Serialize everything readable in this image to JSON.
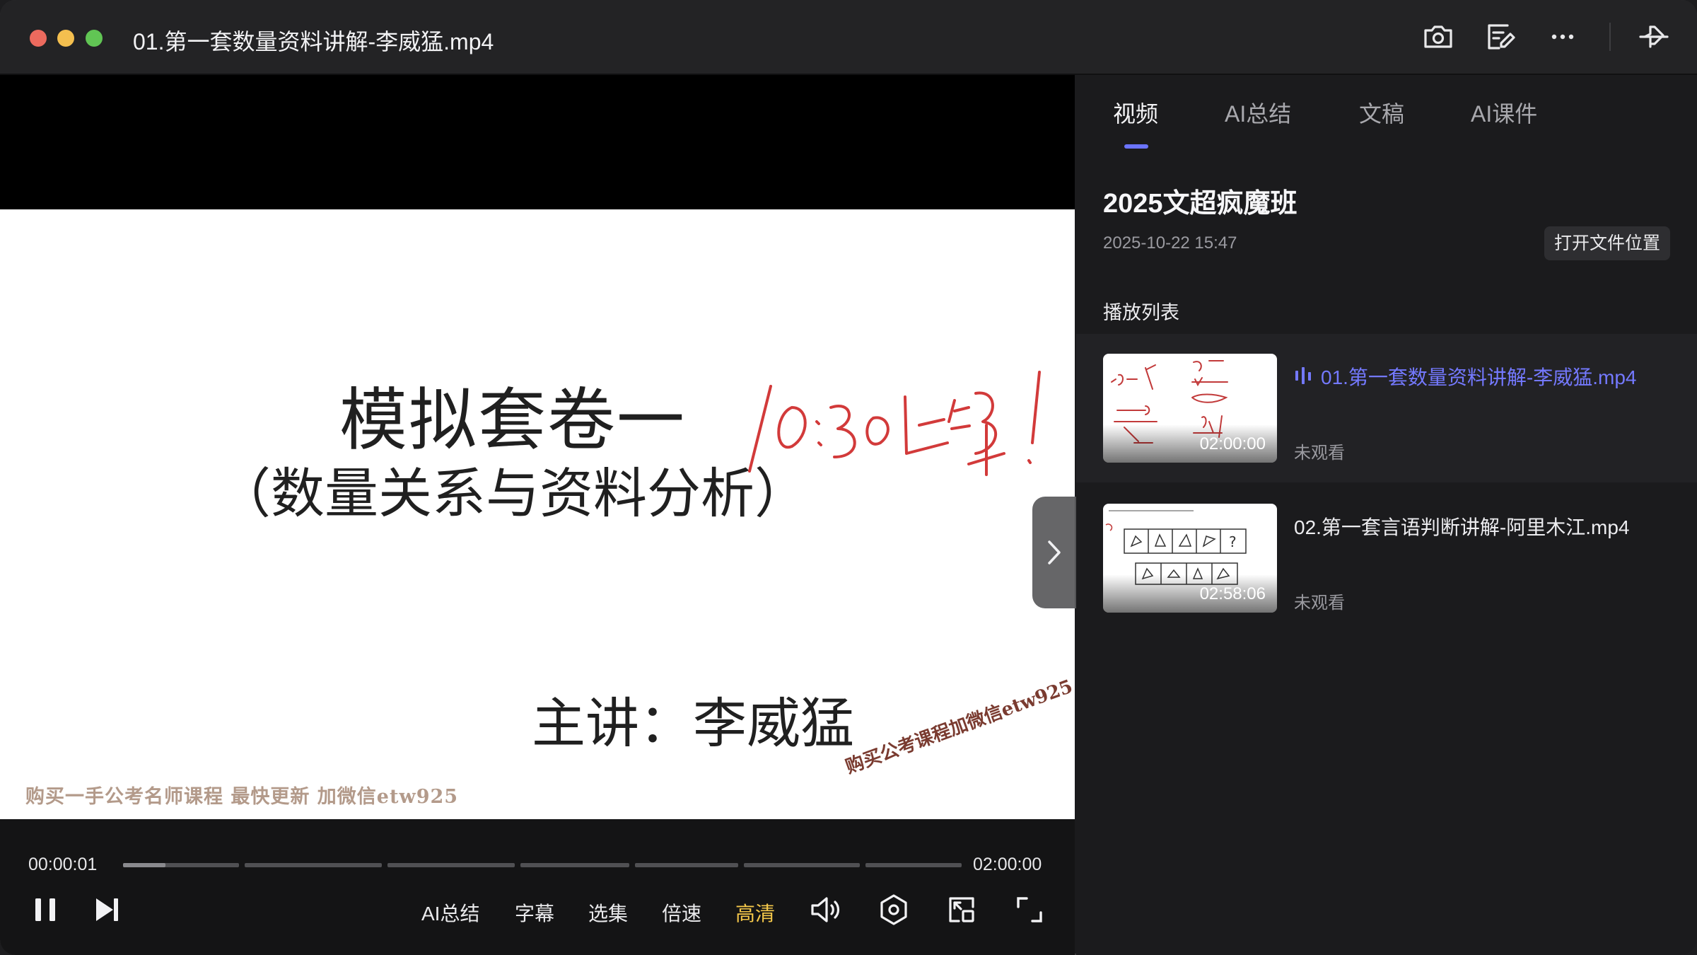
{
  "window": {
    "title": "01.第一套数量资料讲解-李威猛.mp4"
  },
  "titlebar_icons": [
    "camera-icon",
    "edit-note-icon",
    "more-icon",
    "pin-window-icon"
  ],
  "video": {
    "slide": {
      "title": "模拟套卷一",
      "subtitle": "（数量关系与资料分析）",
      "lecturer": "主讲：李威猛",
      "watermark_left": "购买一手公考名师课程  最快更新  加微信etw925",
      "watermark_right": "购买公考课程加微信etw925",
      "handwriting": "10:30上课!"
    }
  },
  "controls": {
    "current_time": "00:00:01",
    "duration": "02:00:00",
    "progress_fraction": 0.0001,
    "ai_summary": "AI总结",
    "subtitles": "字幕",
    "episodes": "选集",
    "speed": "倍速",
    "quality": "高清"
  },
  "panel": {
    "tabs": [
      {
        "label": "视频",
        "active": true
      },
      {
        "label": "AI总结",
        "active": false
      },
      {
        "label": "文稿",
        "active": false
      },
      {
        "label": "AI课件",
        "active": false
      }
    ],
    "course_title": "2025文超疯魔班",
    "course_date": "2025-10-22 15:47",
    "open_folder": "打开文件位置",
    "playlist_label": "播放列表",
    "playlist": [
      {
        "title": "01.第一套数量资料讲解-李威猛.mp4",
        "duration": "02:00:00",
        "status": "未观看",
        "playing": true
      },
      {
        "title": "02.第一套言语判断讲解-阿里木江.mp4",
        "duration": "02:58:06",
        "status": "未观看",
        "playing": false
      }
    ]
  },
  "colors": {
    "accent": "#6b74ff",
    "playing_text": "#7479ff",
    "quality_text": "#f5c84a",
    "background": "#1b1b1d"
  }
}
